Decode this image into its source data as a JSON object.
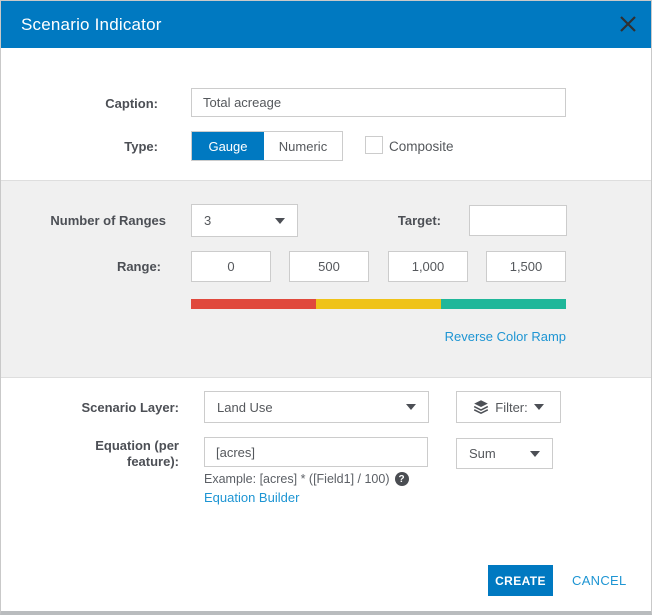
{
  "dialog": {
    "title": "Scenario Indicator"
  },
  "colors": {
    "accent": "#0079c1",
    "link": "#1e95d3",
    "ramp": [
      "#e0493d",
      "#efc319",
      "#1fb79a"
    ]
  },
  "icons": {
    "help": "?"
  },
  "form": {
    "caption": {
      "label": "Caption:",
      "value": "Total acreage"
    },
    "type": {
      "label": "Type:",
      "options": [
        "Gauge",
        "Numeric"
      ],
      "selected": "Gauge",
      "composite_label": "Composite",
      "composite_checked": false
    },
    "ranges": {
      "number_label": "Number of Ranges",
      "number_value": "3",
      "target_label": "Target:",
      "target_value": "",
      "range_label": "Range:",
      "range_values": [
        "0",
        "500",
        "1,000",
        "1,500"
      ],
      "reverse_link": "Reverse Color Ramp"
    },
    "scenario_layer": {
      "label": "Scenario Layer:",
      "value": "Land Use",
      "filter_label": "Filter:"
    },
    "equation": {
      "label_line1": "Equation (per",
      "label_line2": "feature):",
      "value": "[acres]",
      "aggregation": "Sum",
      "example": "Example: [acres] * ([Field1] / 100)",
      "builder_link": "Equation Builder"
    }
  },
  "footer": {
    "create": "CREATE",
    "cancel": "CANCEL"
  }
}
